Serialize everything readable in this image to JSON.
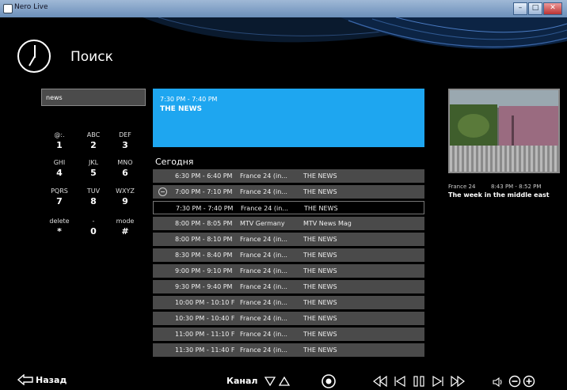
{
  "window": {
    "title": "Nero Live"
  },
  "page": {
    "title": "Поиск"
  },
  "search": {
    "value": "news"
  },
  "keypad": [
    {
      "sub": "@:.",
      "main": "1"
    },
    {
      "sub": "ABC",
      "main": "2"
    },
    {
      "sub": "DEF",
      "main": "3"
    },
    {
      "sub": "GHI",
      "main": "4"
    },
    {
      "sub": "JKL",
      "main": "5"
    },
    {
      "sub": "MNO",
      "main": "6"
    },
    {
      "sub": "PQRS",
      "main": "7"
    },
    {
      "sub": "TUV",
      "main": "8"
    },
    {
      "sub": "WXYZ",
      "main": "9"
    },
    {
      "sub": "delete",
      "main": "*"
    },
    {
      "sub": "-",
      "main": "0"
    },
    {
      "sub": "mode",
      "main": "#"
    }
  ],
  "preview": {
    "time": "7:30 PM - 7:40 PM",
    "title": "THE NEWS"
  },
  "list": {
    "heading": "Сегодня",
    "rows": [
      {
        "time": "6:30 PM - 6:40 PM",
        "channel": "France 24 (in...",
        "program": "THE NEWS"
      },
      {
        "time": "7:00 PM - 7:10 PM",
        "channel": "France 24 (in...",
        "program": "THE NEWS"
      },
      {
        "time": "7:30 PM - 7:40 PM",
        "channel": "France 24 (in...",
        "program": "THE NEWS"
      },
      {
        "time": "8:00 PM - 8:05 PM",
        "channel": "MTV Germany",
        "program": "MTV News Mag"
      },
      {
        "time": "8:00 PM - 8:10 PM",
        "channel": "France 24 (in...",
        "program": "THE NEWS"
      },
      {
        "time": "8:30 PM - 8:40 PM",
        "channel": "France 24 (in...",
        "program": "THE NEWS"
      },
      {
        "time": "9:00 PM - 9:10 PM",
        "channel": "France 24 (in...",
        "program": "THE NEWS"
      },
      {
        "time": "9:30 PM - 9:40 PM",
        "channel": "France 24 (in...",
        "program": "THE NEWS"
      },
      {
        "time": "10:00 PM - 10:10 F",
        "channel": "France 24 (in...",
        "program": "THE NEWS"
      },
      {
        "time": "10:30 PM - 10:40 F",
        "channel": "France 24 (in...",
        "program": "THE NEWS"
      },
      {
        "time": "11:00 PM - 11:10 F",
        "channel": "France 24 (in...",
        "program": "THE NEWS"
      },
      {
        "time": "11:30 PM - 11:40 F",
        "channel": "France 24 (in...",
        "program": "THE NEWS"
      }
    ]
  },
  "side": {
    "channel": "France 24",
    "time": "8:43 PM - 8:52 PM",
    "title": "The week in the middle east"
  },
  "footer": {
    "back_label": "Назад",
    "channel_label": "Канал"
  },
  "colors": {
    "accent": "#1ea6f0",
    "row": "#4a4a4a",
    "background": "#000000"
  },
  "icons": [
    "clock-icon",
    "back-arrow-icon",
    "channel-down-icon",
    "channel-up-icon",
    "record-icon",
    "rewind-icon",
    "previous-icon",
    "pause-icon",
    "next-icon",
    "fast-forward-icon",
    "volume-icon",
    "volume-down-icon",
    "volume-up-icon"
  ]
}
